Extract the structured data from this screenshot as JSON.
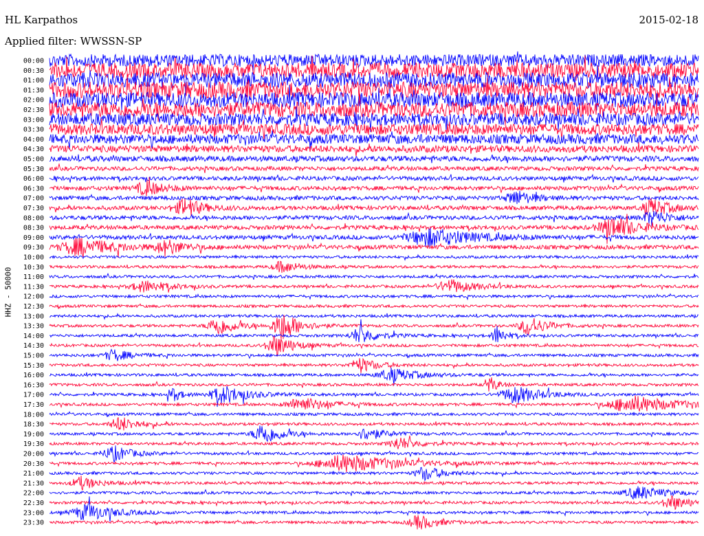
{
  "header": {
    "station": "HL Karpathos",
    "date": "2015-02-18",
    "filter": "Applied filter: WWSSN-SP"
  },
  "chart_data": {
    "type": "line",
    "title": "HL Karpathos",
    "channel_label": "HHZ - 50000",
    "row_labels": [
      "00:00",
      "00:30",
      "01:00",
      "01:30",
      "02:00",
      "02:30",
      "03:00",
      "03:30",
      "04:00",
      "04:30",
      "05:00",
      "05:30",
      "06:00",
      "06:30",
      "07:00",
      "07:30",
      "08:00",
      "08:30",
      "09:00",
      "09:30",
      "10:00",
      "10:30",
      "11:00",
      "11:30",
      "12:00",
      "12:30",
      "13:00",
      "13:30",
      "14:00",
      "14:30",
      "15:00",
      "15:30",
      "16:00",
      "16:30",
      "17:00",
      "17:30",
      "18:00",
      "18:30",
      "19:00",
      "19:30",
      "20:00",
      "20:30",
      "21:00",
      "21:30",
      "22:00",
      "22:30",
      "23:00",
      "23:30"
    ],
    "trace_colors": [
      "#0000ff",
      "#ff0033"
    ],
    "grid": false,
    "noise_amplitude": [
      9,
      11,
      11,
      12,
      11,
      11,
      9,
      8,
      7,
      5,
      4,
      3,
      3,
      3,
      3,
      3,
      3,
      3,
      3,
      3,
      2,
      2,
      2,
      2,
      2,
      2,
      2,
      2,
      2,
      2,
      2,
      2,
      2,
      2,
      2,
      2,
      2,
      2,
      2,
      2,
      2,
      2,
      2,
      2,
      2,
      2,
      2,
      2
    ],
    "events": [
      {
        "row": 13,
        "x": 0.15,
        "amp": 10,
        "w": 0.02
      },
      {
        "row": 14,
        "x": 0.72,
        "amp": 10,
        "w": 0.02
      },
      {
        "row": 15,
        "x": 0.21,
        "amp": 13,
        "w": 0.02
      },
      {
        "row": 15,
        "x": 0.93,
        "amp": 12,
        "w": 0.02
      },
      {
        "row": 16,
        "x": 0.93,
        "amp": 10,
        "w": 0.02
      },
      {
        "row": 17,
        "x": 0.87,
        "amp": 14,
        "w": 0.03
      },
      {
        "row": 18,
        "x": 0.59,
        "amp": 12,
        "w": 0.05
      },
      {
        "row": 19,
        "x": 0.05,
        "amp": 12,
        "w": 0.04
      },
      {
        "row": 19,
        "x": 0.18,
        "amp": 10,
        "w": 0.02
      },
      {
        "row": 21,
        "x": 0.36,
        "amp": 8,
        "w": 0.02
      },
      {
        "row": 23,
        "x": 0.15,
        "amp": 8,
        "w": 0.03
      },
      {
        "row": 23,
        "x": 0.62,
        "amp": 9,
        "w": 0.03
      },
      {
        "row": 27,
        "x": 0.26,
        "amp": 14,
        "w": 0.02
      },
      {
        "row": 27,
        "x": 0.36,
        "amp": 20,
        "w": 0.02
      },
      {
        "row": 27,
        "x": 0.74,
        "amp": 14,
        "w": 0.02
      },
      {
        "row": 28,
        "x": 0.48,
        "amp": 12,
        "w": 0.02
      },
      {
        "row": 28,
        "x": 0.69,
        "amp": 14,
        "w": 0.01
      },
      {
        "row": 29,
        "x": 0.35,
        "amp": 15,
        "w": 0.02
      },
      {
        "row": 30,
        "x": 0.1,
        "amp": 8,
        "w": 0.02
      },
      {
        "row": 31,
        "x": 0.48,
        "amp": 10,
        "w": 0.02
      },
      {
        "row": 32,
        "x": 0.53,
        "amp": 9,
        "w": 0.03
      },
      {
        "row": 33,
        "x": 0.68,
        "amp": 10,
        "w": 0.01
      },
      {
        "row": 34,
        "x": 0.19,
        "amp": 10,
        "w": 0.01
      },
      {
        "row": 34,
        "x": 0.27,
        "amp": 12,
        "w": 0.03
      },
      {
        "row": 34,
        "x": 0.72,
        "amp": 12,
        "w": 0.03
      },
      {
        "row": 35,
        "x": 0.39,
        "amp": 10,
        "w": 0.03
      },
      {
        "row": 35,
        "x": 0.9,
        "amp": 12,
        "w": 0.05
      },
      {
        "row": 37,
        "x": 0.11,
        "amp": 10,
        "w": 0.02
      },
      {
        "row": 38,
        "x": 0.33,
        "amp": 16,
        "w": 0.02
      },
      {
        "row": 38,
        "x": 0.49,
        "amp": 9,
        "w": 0.02
      },
      {
        "row": 39,
        "x": 0.54,
        "amp": 9,
        "w": 0.02
      },
      {
        "row": 40,
        "x": 0.1,
        "amp": 11,
        "w": 0.02
      },
      {
        "row": 41,
        "x": 0.46,
        "amp": 12,
        "w": 0.06
      },
      {
        "row": 42,
        "x": 0.58,
        "amp": 10,
        "w": 0.02
      },
      {
        "row": 43,
        "x": 0.05,
        "amp": 9,
        "w": 0.02
      },
      {
        "row": 44,
        "x": 0.91,
        "amp": 9,
        "w": 0.03
      },
      {
        "row": 45,
        "x": 0.96,
        "amp": 10,
        "w": 0.02
      },
      {
        "row": 46,
        "x": 0.06,
        "amp": 12,
        "w": 0.03
      },
      {
        "row": 47,
        "x": 0.57,
        "amp": 10,
        "w": 0.02
      }
    ]
  }
}
